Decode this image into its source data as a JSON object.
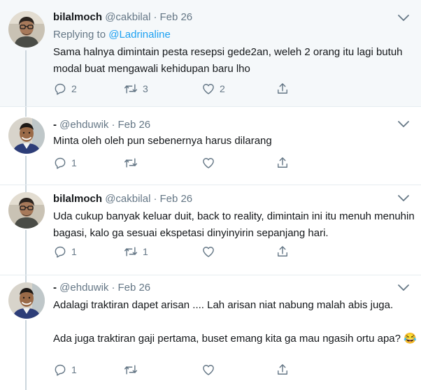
{
  "tweets": [
    {
      "name": "bilalmoch",
      "handle": "@cakbilal",
      "sep": "·",
      "date": "Feb 26",
      "replying_prefix": "Replying to",
      "replying_to": "@Ladrinaline",
      "text": "Sama halnya dimintain pesta resepsi gede2an, weleh 2 orang itu lagi butuh modal buat mengawali kehidupan baru lho",
      "replies": "2",
      "retweets": "3",
      "likes": "2"
    },
    {
      "name": "-",
      "handle": "@ehduwik",
      "sep": "·",
      "date": "Feb 26",
      "text": "Minta oleh oleh pun sebenernya harus dilarang",
      "replies": "1",
      "retweets": "",
      "likes": ""
    },
    {
      "name": "bilalmoch",
      "handle": "@cakbilal",
      "sep": "·",
      "date": "Feb 26",
      "text": "Uda cukup banyak keluar duit, back to reality, dimintain ini itu menuh menuhin bagasi, kalo ga sesuai ekspetasi dinyinyirin sepanjang hari.",
      "replies": "1",
      "retweets": "1",
      "likes": ""
    },
    {
      "name": "-",
      "handle": "@ehduwik",
      "sep": "·",
      "date": "Feb 26",
      "text": "Adalagi traktiran dapet arisan .... Lah arisan niat nabung malah abis juga.\n\nAda juga traktiran gaji pertama, buset emang kita ga mau ngasih ortu apa? 😂",
      "replies": "1",
      "retweets": "",
      "likes": ""
    }
  ],
  "icons": {
    "reply": "reply-icon",
    "retweet": "retweet-icon",
    "like": "heart-icon",
    "share": "share-icon",
    "caret": "chevron-down-icon"
  },
  "colors": {
    "text": "#14171a",
    "muted": "#657786",
    "link": "#1da1f2",
    "thread_line": "#ccd6dd",
    "highlight_bg": "#f5f8fa"
  }
}
